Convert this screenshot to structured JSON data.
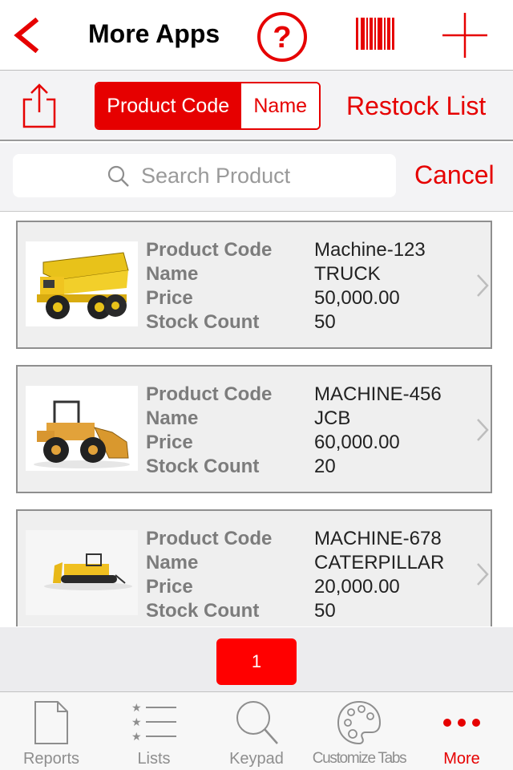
{
  "navbar": {
    "title": "More Apps",
    "icons": [
      "back-chevron-icon",
      "help-icon",
      "barcode-icon",
      "add-icon"
    ]
  },
  "toolbar": {
    "segments": [
      "Product Code",
      "Name"
    ],
    "selected_segment": "Product Code",
    "restock_label": "Restock List"
  },
  "search": {
    "placeholder": "Search Product",
    "cancel_label": "Cancel"
  },
  "products": [
    {
      "labels": [
        "Product Code",
        "Name",
        "Price",
        "Stock Count"
      ],
      "code": "Machine-123",
      "name": "TRUCK",
      "price": "50,000.00",
      "stock": "50"
    },
    {
      "labels": [
        "Product Code",
        "Name",
        "Price",
        "Stock Count"
      ],
      "code": "MACHINE-456",
      "name": "JCB",
      "price": "60,000.00",
      "stock": "20"
    },
    {
      "labels": [
        "Product Code",
        "Name",
        "Price",
        "Stock Count"
      ],
      "code": "MACHINE-678",
      "name": "CATERPILLAR",
      "price": "20,000.00",
      "stock": "50"
    }
  ],
  "pagination": {
    "current_page": "1"
  },
  "tabs": [
    {
      "label": "Reports",
      "icon": "document-icon"
    },
    {
      "label": "Lists",
      "icon": "list-icon"
    },
    {
      "label": "Keypad",
      "icon": "magnifier-icon"
    },
    {
      "label": "Customize Tabs",
      "icon": "palette-icon"
    },
    {
      "label": "More",
      "icon": "more-dots-icon"
    }
  ],
  "active_tab": "More",
  "colors": {
    "accent": "#e60000",
    "pager_button": "#ff0000",
    "card_bg": "#efefef"
  }
}
